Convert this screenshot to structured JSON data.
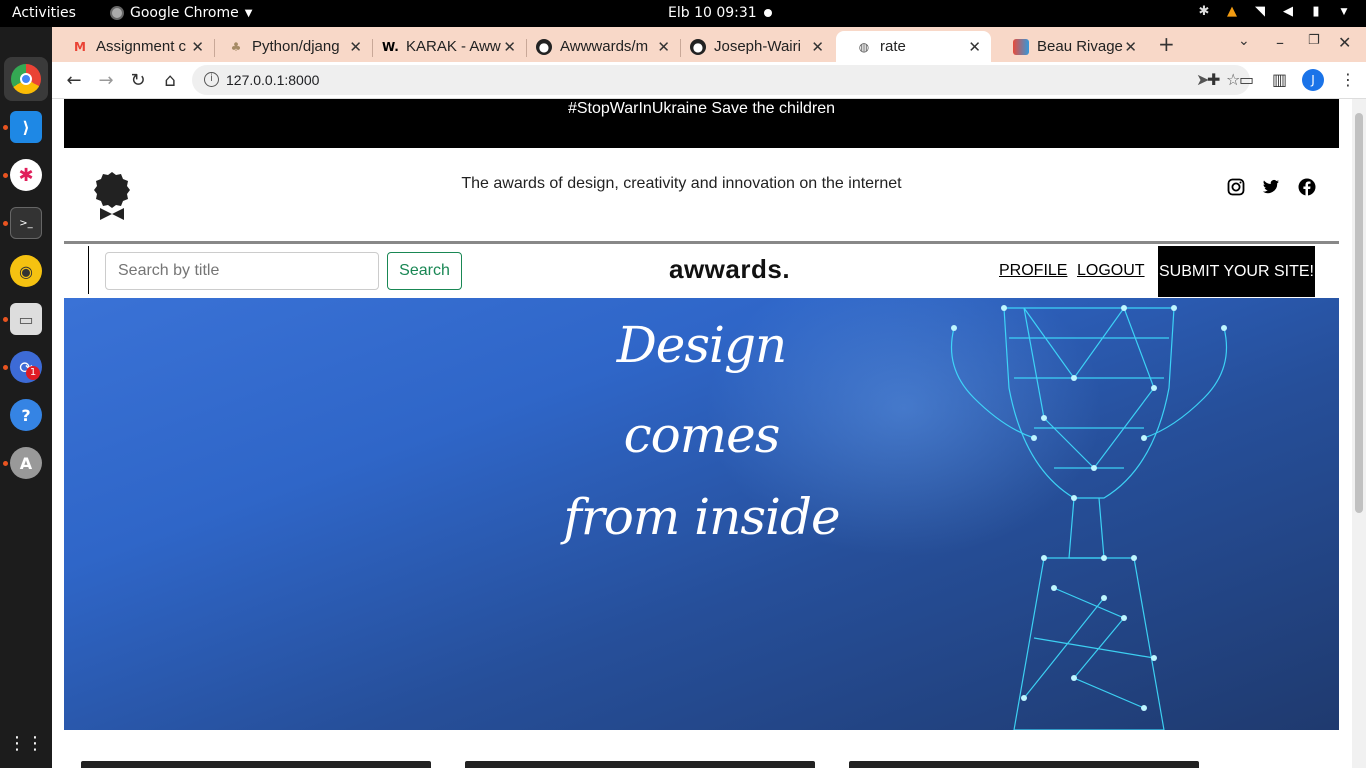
{
  "system": {
    "activities": "Activities",
    "app_name": "Google Chrome",
    "clock": "Elb 10  09:31"
  },
  "dock": {
    "badge": "1",
    "items": [
      "chrome-icon",
      "vscode-icon",
      "slack-icon",
      "terminal-icon",
      "rhythmbox-icon",
      "files-icon",
      "updater-icon",
      "help-icon",
      "software-icon",
      "app-grid-icon"
    ]
  },
  "browser": {
    "tabs": [
      {
        "label": "Assignment c",
        "icon": "gmail-icon"
      },
      {
        "label": "Python/djang",
        "icon": "python-icon"
      },
      {
        "label": "KARAK - Aww",
        "icon": "awwwards-icon"
      },
      {
        "label": "Awwwards/m",
        "icon": "github-icon"
      },
      {
        "label": "Joseph-Wairi",
        "icon": "github-icon"
      },
      {
        "label": "rate",
        "icon": "globe-icon"
      },
      {
        "label": "Beau Rivage",
        "icon": "beaurivage-icon"
      }
    ],
    "active_tab": 5,
    "url": "127.0.0.1:8000",
    "profile_initial": "J"
  },
  "page": {
    "banner": "#StopWarInUkraine Save the children",
    "tagline": "The awards of design, creativity and innovation on the internet",
    "search": {
      "placeholder": "Search by title",
      "button": "Search"
    },
    "brand": "awwards.",
    "nav": {
      "profile": "PROFILE",
      "logout": "LOGOUT",
      "submit": "SUBMIT YOUR SITE!"
    },
    "hero": {
      "line1": "Design",
      "line2": "comes",
      "line3": "from inside"
    },
    "social": [
      "instagram-icon",
      "twitter-icon",
      "facebook-icon"
    ]
  },
  "colors": {
    "tab_bar": "#f8d8c8",
    "banner": "#000000",
    "search_button": "#198754",
    "hero_blue": "#2f66c8",
    "trophy_cyan": "#3fe0ff"
  }
}
